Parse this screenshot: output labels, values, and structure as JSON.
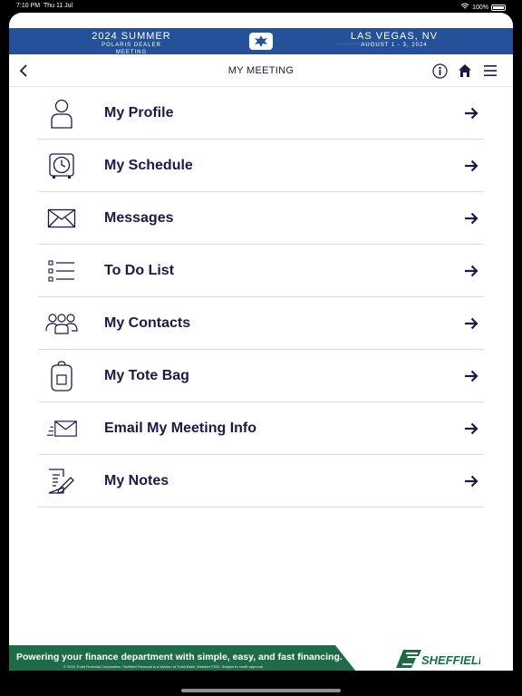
{
  "status": {
    "time": "7:10 PM",
    "date": "Thu 11 Jul",
    "battery": "100%"
  },
  "banner": {
    "left_line1": "2024 SUMMER",
    "left_line2": "POLARIS DEALER MEETING",
    "right_line1": "LAS VEGAS, NV",
    "right_line2": "AUGUST 1 - 3, 2024"
  },
  "nav": {
    "title": "MY MEETING",
    "back_icon": "chevron-left-icon",
    "info_icon": "info-icon",
    "home_icon": "home-icon",
    "menu_icon": "hamburger-menu-icon"
  },
  "menu": [
    {
      "label": "My Profile",
      "icon": "person-icon"
    },
    {
      "label": "My Schedule",
      "icon": "clock-icon"
    },
    {
      "label": "Messages",
      "icon": "envelope-icon"
    },
    {
      "label": "To Do List",
      "icon": "checklist-icon"
    },
    {
      "label": "My Contacts",
      "icon": "group-icon"
    },
    {
      "label": "My Tote Bag",
      "icon": "bag-icon"
    },
    {
      "label": "Email My Meeting Info",
      "icon": "send-mail-icon"
    },
    {
      "label": "My Notes",
      "icon": "notes-icon"
    }
  ],
  "footer": {
    "tagline": "Powering your finance department with simple, easy, and fast financing.",
    "fine_print": "© 2024 Truist Financial Corporation. Sheffield Financial is a division of Truist Bank, Member FDIC. Subject to credit approval.",
    "brand": "SHEFFIELD"
  },
  "colors": {
    "banner": "#24519a",
    "text": "#1b1a45",
    "footer_green": "#1f6b48"
  }
}
